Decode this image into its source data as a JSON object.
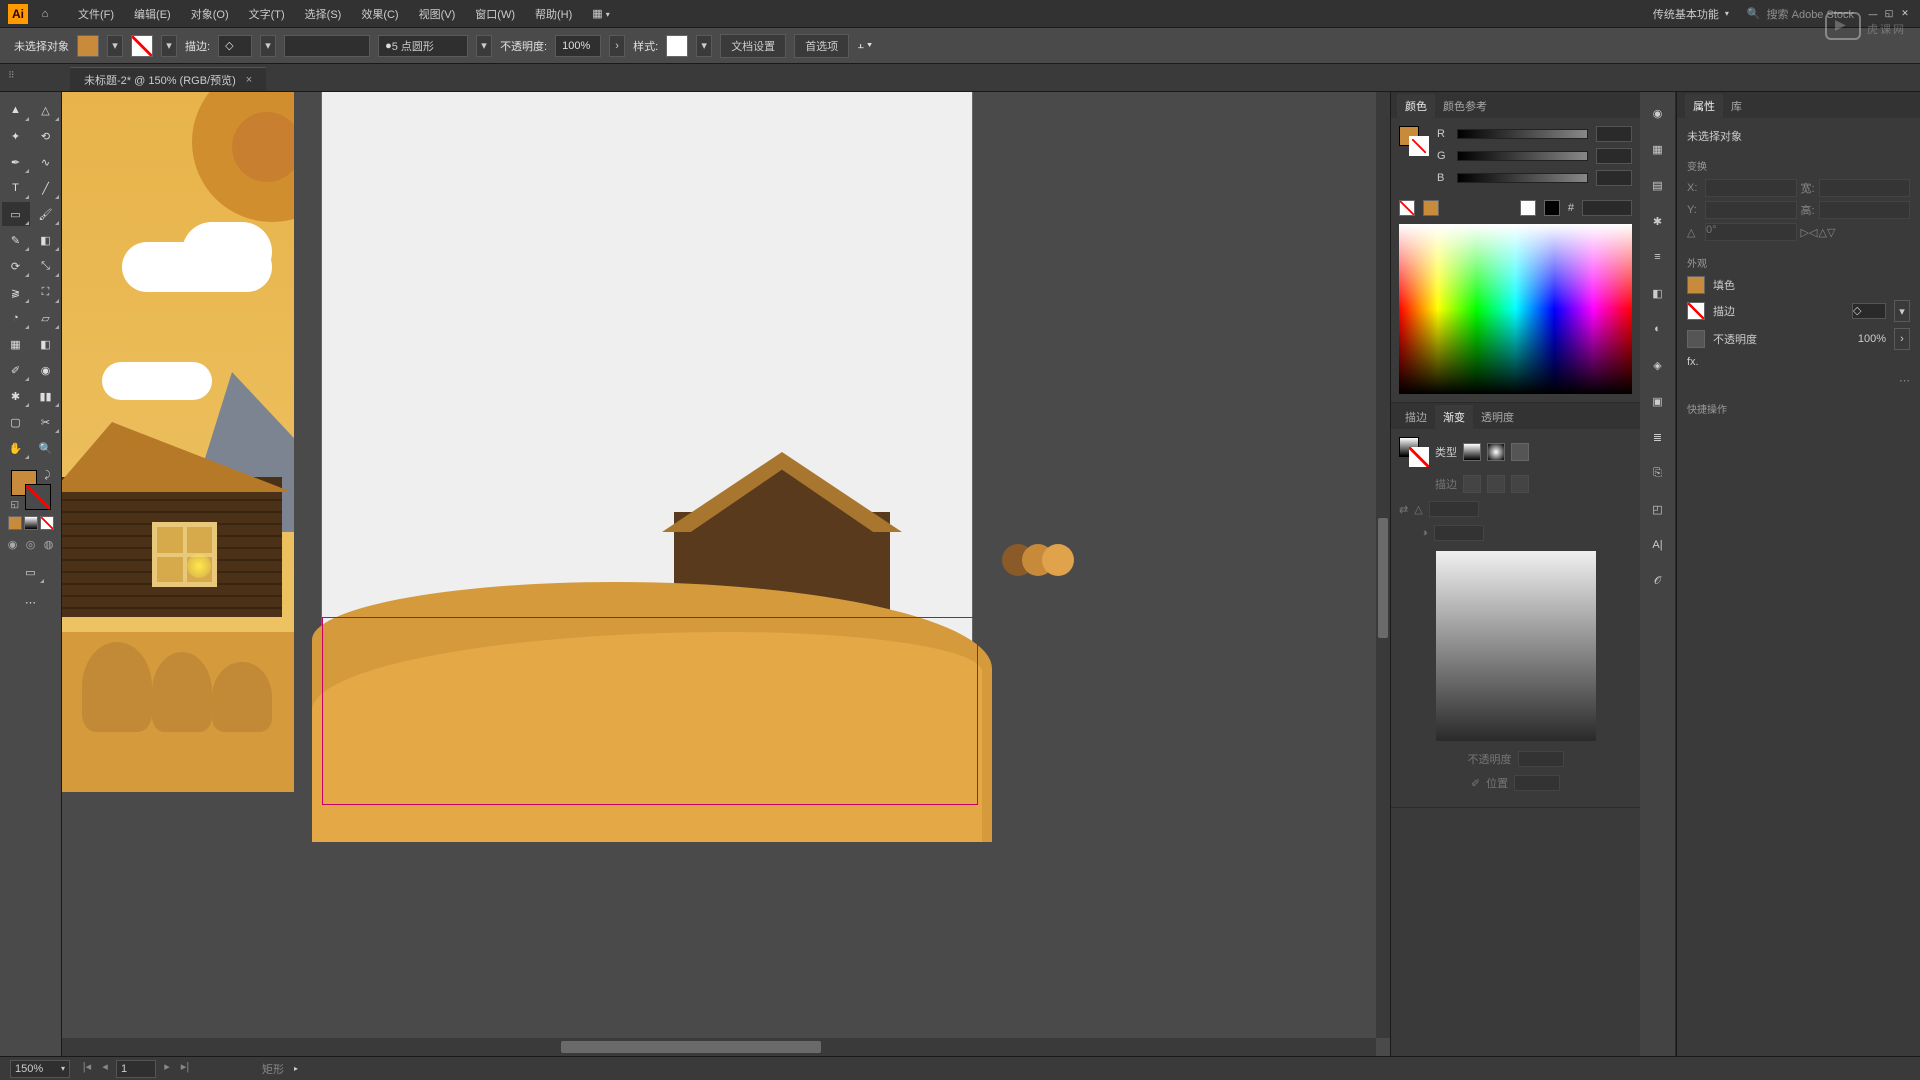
{
  "menubar": {
    "items": [
      "文件(F)",
      "编辑(E)",
      "对象(O)",
      "文字(T)",
      "选择(S)",
      "效果(C)",
      "视图(V)",
      "窗口(W)",
      "帮助(H)"
    ],
    "workspace": "传统基本功能",
    "search_placeholder": "搜索 Adobe Stock"
  },
  "controlbar": {
    "selection": "未选择对象",
    "stroke_label": "描边:",
    "stroke_profile": "5 点圆形",
    "opacity_label": "不透明度:",
    "opacity_value": "100%",
    "style_label": "样式:",
    "doc_setup": "文档设置",
    "prefs": "首选项"
  },
  "document": {
    "tab_title": "未标题-2* @ 150% (RGB/预览)",
    "zoom": "150%"
  },
  "color_panel": {
    "tabs": [
      "颜色",
      "颜色参考"
    ],
    "channels": [
      "R",
      "G",
      "B"
    ],
    "hex_label": "#"
  },
  "gradient_panel": {
    "tabs": [
      "描边",
      "渐变",
      "透明度"
    ],
    "type_label": "类型",
    "stroke_label": "描边",
    "angle_label": "△",
    "ratio_label": "◑",
    "opacity_label": "不透明度",
    "position_label": "位置"
  },
  "properties_panel": {
    "tabs": [
      "属性",
      "库"
    ],
    "no_selection": "未选择对象",
    "transform_title": "变换",
    "transform": {
      "x": "X:",
      "y": "Y:",
      "w": "宽:",
      "h": "高:",
      "angle": "△",
      "angle_val": "0°"
    },
    "appearance_title": "外观",
    "fill_label": "填色",
    "stroke_label": "描边",
    "opacity_label": "不透明度",
    "opacity_value": "100%",
    "fx_label": "fx.",
    "quick_title": "快捷操作"
  },
  "statusbar": {
    "tool": "矩形"
  },
  "colors": {
    "fill": "#c88b3c",
    "accent": "#ff9a00"
  },
  "watermark": "虎课网"
}
